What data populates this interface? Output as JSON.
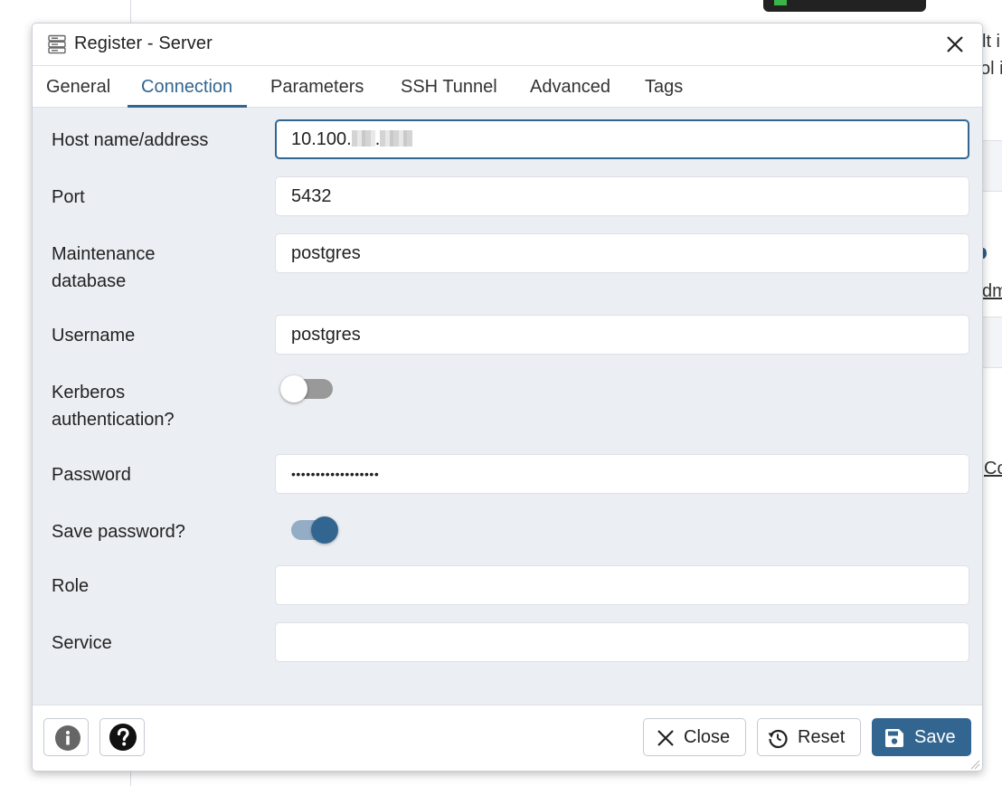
{
  "background": {
    "right_fragments": [
      "lt i",
      "ol i",
      "dm",
      "Co"
    ]
  },
  "dialog": {
    "title": "Register - Server",
    "tabs": [
      {
        "label": "General"
      },
      {
        "label": "Connection"
      },
      {
        "label": "Parameters"
      },
      {
        "label": "SSH Tunnel"
      },
      {
        "label": "Advanced"
      },
      {
        "label": "Tags"
      }
    ],
    "active_tab": "Connection",
    "fields": {
      "host": {
        "label": "Host name/address",
        "value_prefix": "10.100.",
        "value_sep": "."
      },
      "port": {
        "label": "Port",
        "value": "5432"
      },
      "maintenance_db": {
        "label_line1": "Maintenance",
        "label_line2": "database",
        "value": "postgres"
      },
      "username": {
        "label": "Username",
        "value": "postgres"
      },
      "kerberos": {
        "label_line1": "Kerberos",
        "label_line2": "authentication?",
        "enabled": false
      },
      "password": {
        "label": "Password",
        "value_masked": "••••••••••••••••••"
      },
      "save_password": {
        "label": "Save password?",
        "enabled": true
      },
      "role": {
        "label": "Role",
        "value": ""
      },
      "service": {
        "label": "Service",
        "value": ""
      }
    },
    "footer": {
      "close_label": "Close",
      "reset_label": "Reset",
      "save_label": "Save"
    },
    "colors": {
      "accent": "#326690",
      "form_bg": "#ebeef3",
      "toggle_off": "#999999",
      "toggle_on_track": "#94adc6"
    },
    "icons": [
      "server-icon",
      "close-icon",
      "info-icon",
      "help-icon",
      "close-x-icon",
      "reset-icon",
      "save-icon"
    ]
  }
}
